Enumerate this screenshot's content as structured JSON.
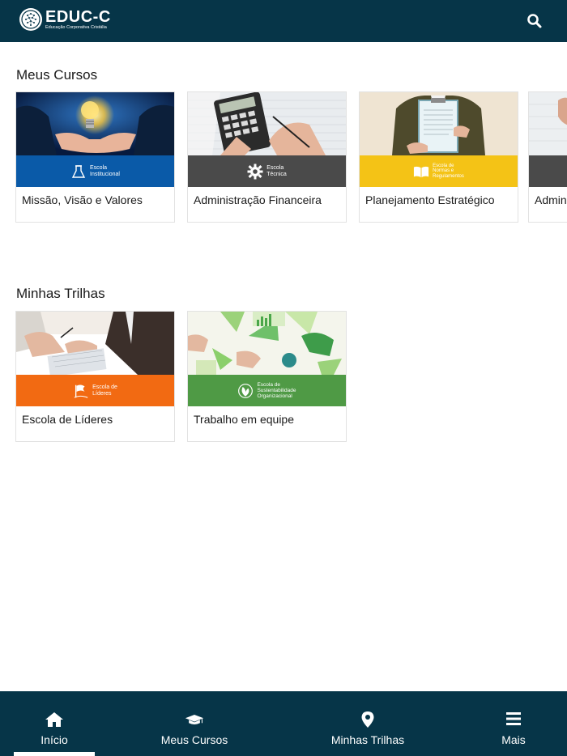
{
  "header": {
    "logo_title": "EDUC-C",
    "logo_subtitle": "Educação Corporativa Cristália",
    "search_icon": "search-icon",
    "background": "#063548"
  },
  "courses_section": {
    "title": "Meus Cursos",
    "cards": [
      {
        "title": "Missão, Visão e Valores",
        "band_label": "Escola\nInstitucional",
        "band_color": "#0a5aa8",
        "icon": "flask-icon"
      },
      {
        "title": "Administração Financeira",
        "band_label": "Escola\nTécnica",
        "band_color": "#4a4a4a",
        "icon": "gear-icon"
      },
      {
        "title": "Planejamento Estratégico",
        "band_label": "Escola de\nNormas e\nRegulamentos",
        "band_color": "#f4c316",
        "icon": "book-icon"
      },
      {
        "title": "Admin",
        "band_label": "",
        "band_color": "#4a4a4a",
        "icon": ""
      }
    ]
  },
  "trails_section": {
    "title": "Minhas Trilhas",
    "cards": [
      {
        "title": "Escola de Líderes",
        "band_label": "Escola de\nLíderes",
        "band_color": "#f26a12",
        "icon": "flag-icon"
      },
      {
        "title": "Trabalho em equipe",
        "band_label": "Escola de\nSustentabilidade\nOrganizacional",
        "band_color": "#4f9a45",
        "icon": "leaf-icon"
      }
    ]
  },
  "bottom_nav": {
    "items": [
      {
        "label": "Início",
        "icon": "home-icon"
      },
      {
        "label": "Meus Cursos",
        "icon": "graduation-cap-icon"
      },
      {
        "label": "Minhas Trilhas",
        "icon": "map-pin-icon"
      },
      {
        "label": "Mais",
        "icon": "menu-icon"
      }
    ],
    "active": "Início"
  }
}
